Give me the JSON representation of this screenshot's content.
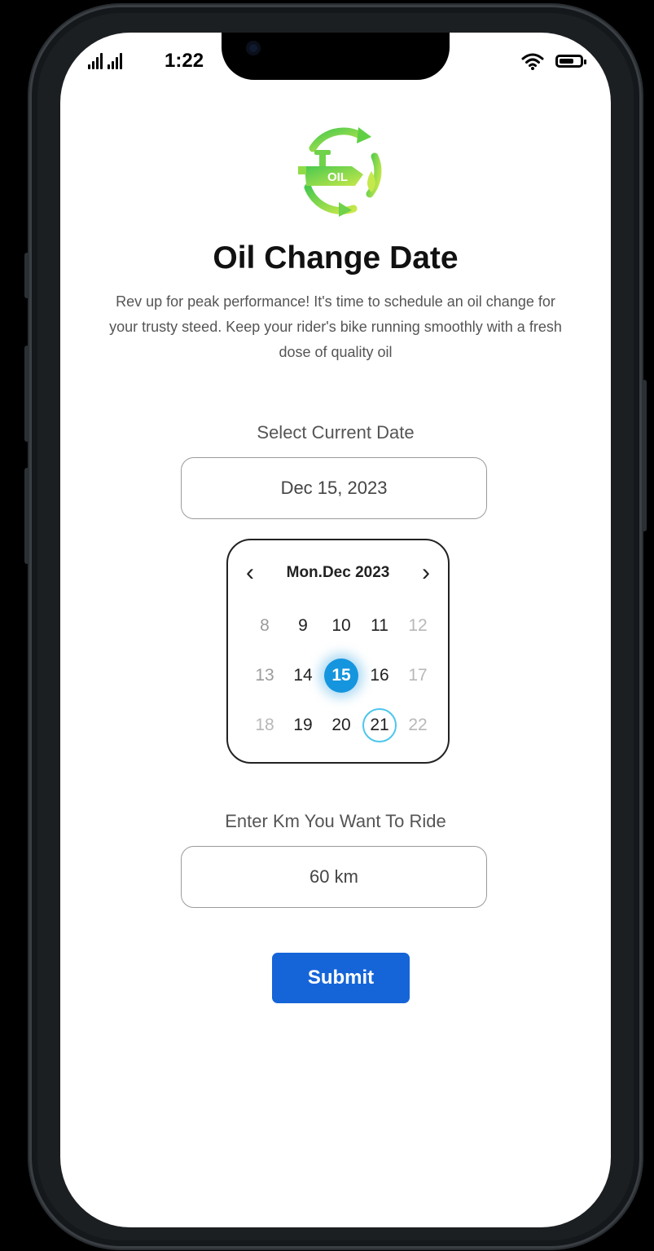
{
  "status_bar": {
    "time": "1:22"
  },
  "page": {
    "title": "Oil Change Date",
    "description": "Rev up for peak performance! It's time to schedule an oil change for your trusty steed. Keep your rider's bike running smoothly with a fresh dose of quality oil",
    "logo_text": "OIL"
  },
  "date_section": {
    "label": "Select Current Date",
    "value": "Dec 15, 2023"
  },
  "calendar": {
    "month_title": "Mon.Dec 2023",
    "rows": [
      [
        "8",
        "9",
        "10",
        "11",
        "12"
      ],
      [
        "13",
        "14",
        "15",
        "16",
        "17"
      ],
      [
        "18",
        "19",
        "20",
        "21",
        "22"
      ]
    ],
    "selected_day": "15",
    "today_day": "21"
  },
  "km_section": {
    "label": "Enter Km You Want To Ride",
    "value": "60 km"
  },
  "submit_label": "Submit",
  "colors": {
    "accent": "#1565d8",
    "selected": "#1595de",
    "ring": "#4cc6ee",
    "logo_green": "#7ed348"
  }
}
